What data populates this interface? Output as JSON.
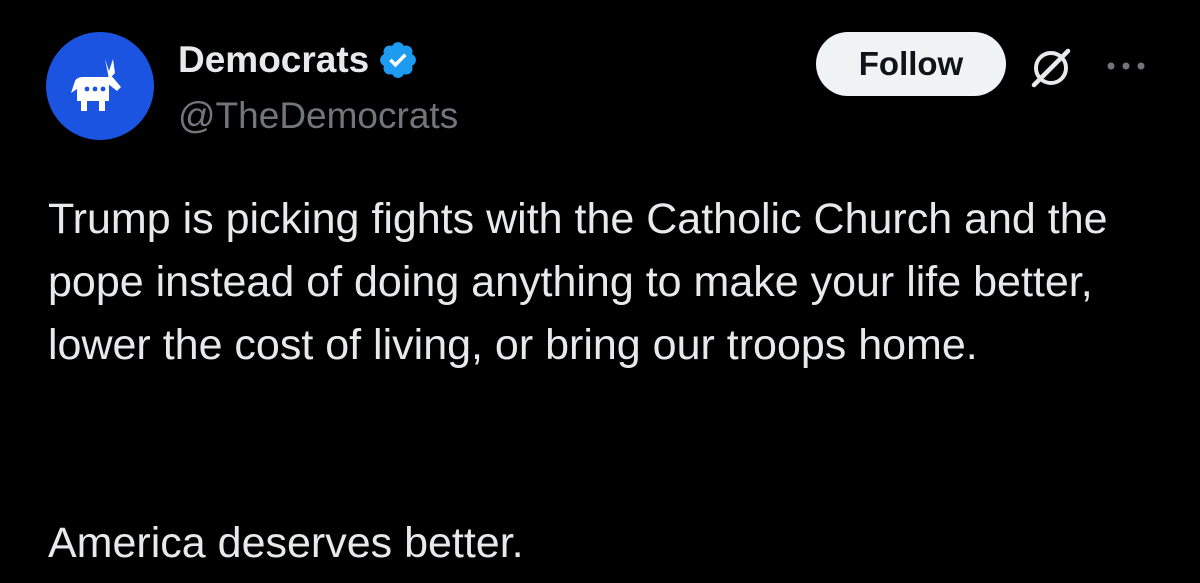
{
  "author": {
    "display_name": "Democrats",
    "handle": "@TheDemocrats",
    "avatar_icon": "democratic-donkey-icon",
    "avatar_color": "#1a54e0",
    "verified_icon": "verified-badge-icon",
    "verified_color": "#1d9bf0"
  },
  "actions": {
    "follow_label": "Follow",
    "grok_icon": "grok-icon",
    "more_icon": "more-options-icon"
  },
  "post": {
    "paragraph_1": "Trump is picking fights with the Catholic Church and the pope instead of doing anything to make your life better, lower the cost of living, or bring our troops home.",
    "paragraph_2": "America deserves better."
  }
}
